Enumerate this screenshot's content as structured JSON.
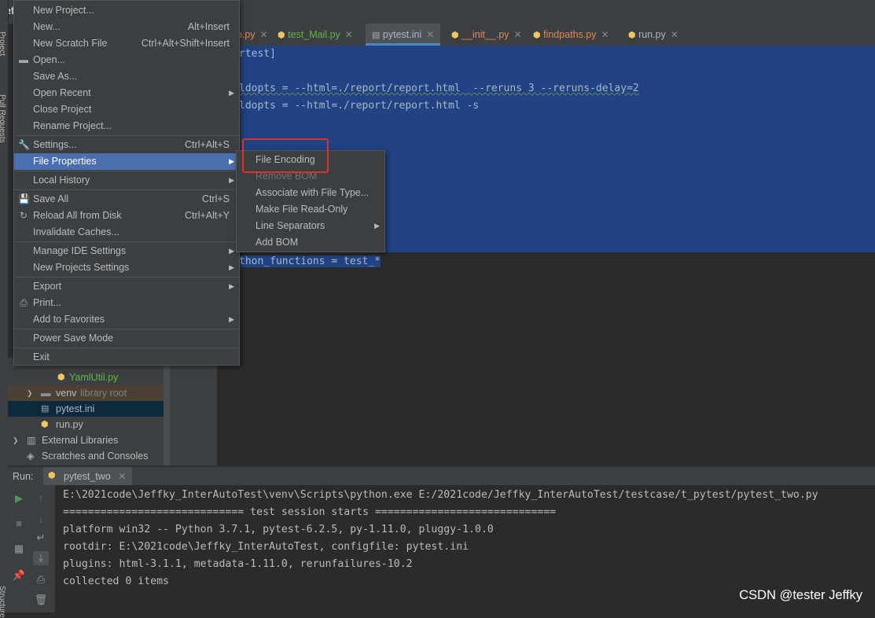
{
  "window": {
    "title_fragment": "Jeff"
  },
  "side_tabs": {
    "project": "Project",
    "pull_requests": "Pull Requests",
    "structure": "Structure"
  },
  "editor_tabs": [
    {
      "label": "p.py",
      "active": false
    },
    {
      "label": "test_Mail.py",
      "active": false
    },
    {
      "label": "pytest.ini",
      "active": true
    },
    {
      "label": "__init__.py",
      "active": false
    },
    {
      "label": "findpaths.py",
      "active": false
    },
    {
      "label": "run.py",
      "active": false
    }
  ],
  "editor": {
    "lines": [
      "rtest]",
      "",
      "ldopts = --html=./report/report.html  --reruns 3 --reruns-delay=2",
      "ldopts = --html=./report/report.html -s",
      "",
      "",
      "",
      "",
      "",
      "",
      "",
      "",
      "thon_functions = test_*"
    ]
  },
  "project_tree": [
    {
      "label": "YamlUtil.py",
      "type": "python"
    },
    {
      "label": "venv",
      "suffix": "library root",
      "type": "folder"
    },
    {
      "label": "pytest.ini",
      "type": "ini",
      "selected": true
    },
    {
      "label": "run.py",
      "type": "python"
    },
    {
      "label": "External Libraries",
      "type": "library"
    },
    {
      "label": "Scratches and Consoles",
      "type": "scratch"
    }
  ],
  "file_menu": {
    "items": [
      {
        "label": "New Project...",
        "shortcut": ""
      },
      {
        "label": "New...",
        "shortcut": "Alt+Insert"
      },
      {
        "label": "New Scratch File",
        "shortcut": "Ctrl+Alt+Shift+Insert"
      },
      {
        "label": "Open...",
        "shortcut": "",
        "icon": "folder-icon"
      },
      {
        "label": "Save As...",
        "shortcut": ""
      },
      {
        "label": "Open Recent",
        "shortcut": "",
        "submenu": true
      },
      {
        "label": "Close Project",
        "shortcut": ""
      },
      {
        "label": "Rename Project...",
        "shortcut": ""
      },
      {
        "label": "Settings...",
        "shortcut": "Ctrl+Alt+S",
        "icon": "wrench-icon"
      },
      {
        "label": "File Properties",
        "shortcut": "",
        "submenu": true,
        "selected": true
      },
      {
        "label": "Local History",
        "shortcut": "",
        "submenu": true
      },
      {
        "label": "Save All",
        "shortcut": "Ctrl+S",
        "icon": "save-icon"
      },
      {
        "label": "Reload All from Disk",
        "shortcut": "Ctrl+Alt+Y",
        "icon": "reload-icon"
      },
      {
        "label": "Invalidate Caches...",
        "shortcut": ""
      },
      {
        "label": "Manage IDE Settings",
        "shortcut": "",
        "submenu": true
      },
      {
        "label": "New Projects Settings",
        "shortcut": "",
        "submenu": true
      },
      {
        "label": "Export",
        "shortcut": "",
        "submenu": true
      },
      {
        "label": "Print...",
        "shortcut": "",
        "icon": "print-icon"
      },
      {
        "label": "Add to Favorites",
        "shortcut": "",
        "submenu": true
      },
      {
        "label": "Power Save Mode",
        "shortcut": ""
      },
      {
        "label": "Exit",
        "shortcut": ""
      }
    ]
  },
  "file_properties_submenu": {
    "items": [
      {
        "label": "File Encoding",
        "enabled": true,
        "highlighted": true
      },
      {
        "label": "Remove BOM",
        "enabled": false
      },
      {
        "label": "Associate with File Type...",
        "enabled": true
      },
      {
        "label": "Make File Read-Only",
        "enabled": true
      },
      {
        "label": "Line Separators",
        "enabled": true,
        "submenu": true
      },
      {
        "label": "Add BOM",
        "enabled": true
      }
    ]
  },
  "run_panel": {
    "label": "Run:",
    "config": "pytest_two",
    "output": [
      "E:\\2021code\\Jeffky_InterAutoTest\\venv\\Scripts\\python.exe E:/2021code/Jeffky_InterAutoTest/testcase/t_pytest/pytest_two.py",
      "============================= test session starts =============================",
      "platform win32 -- Python 3.7.1, pytest-6.2.5, py-1.11.0, pluggy-1.0.0",
      "rootdir: E:\\2021code\\Jeffky_InterAutoTest, configfile: pytest.ini",
      "plugins: html-3.1.1, metadata-1.11.0, rerunfailures-10.2",
      "collected 0 items"
    ]
  },
  "watermark": "CSDN @tester Jeffky",
  "colors": {
    "menu_bg": "#3c3f41",
    "menu_selected": "#4b6eaf",
    "editor_selection": "#214283",
    "highlight_box": "#e0302a"
  }
}
